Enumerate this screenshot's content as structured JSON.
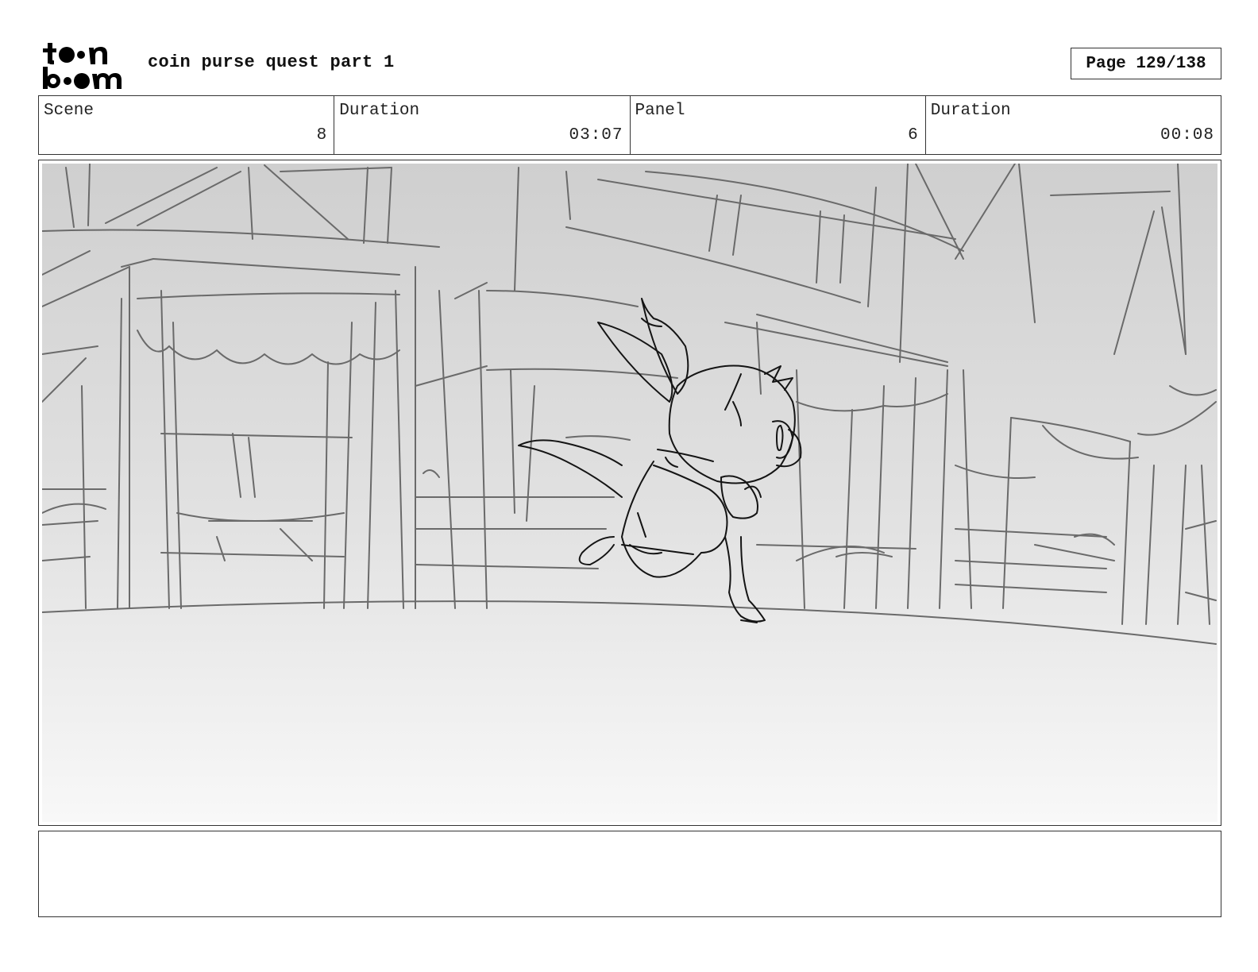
{
  "header": {
    "logo_text": "toon boom",
    "project_title": "coin purse quest part 1",
    "page_label": "Page 129/138"
  },
  "info_bar": {
    "scene_label": "Scene",
    "scene_value": "8",
    "scene_duration_label": "Duration",
    "scene_duration_value": "03:07",
    "panel_label": "Panel",
    "panel_value": "6",
    "panel_duration_label": "Duration",
    "panel_duration_value": "00:08"
  },
  "panel": {
    "image_icon": "storyboard-sketch-image"
  },
  "notes": {
    "text": ""
  }
}
